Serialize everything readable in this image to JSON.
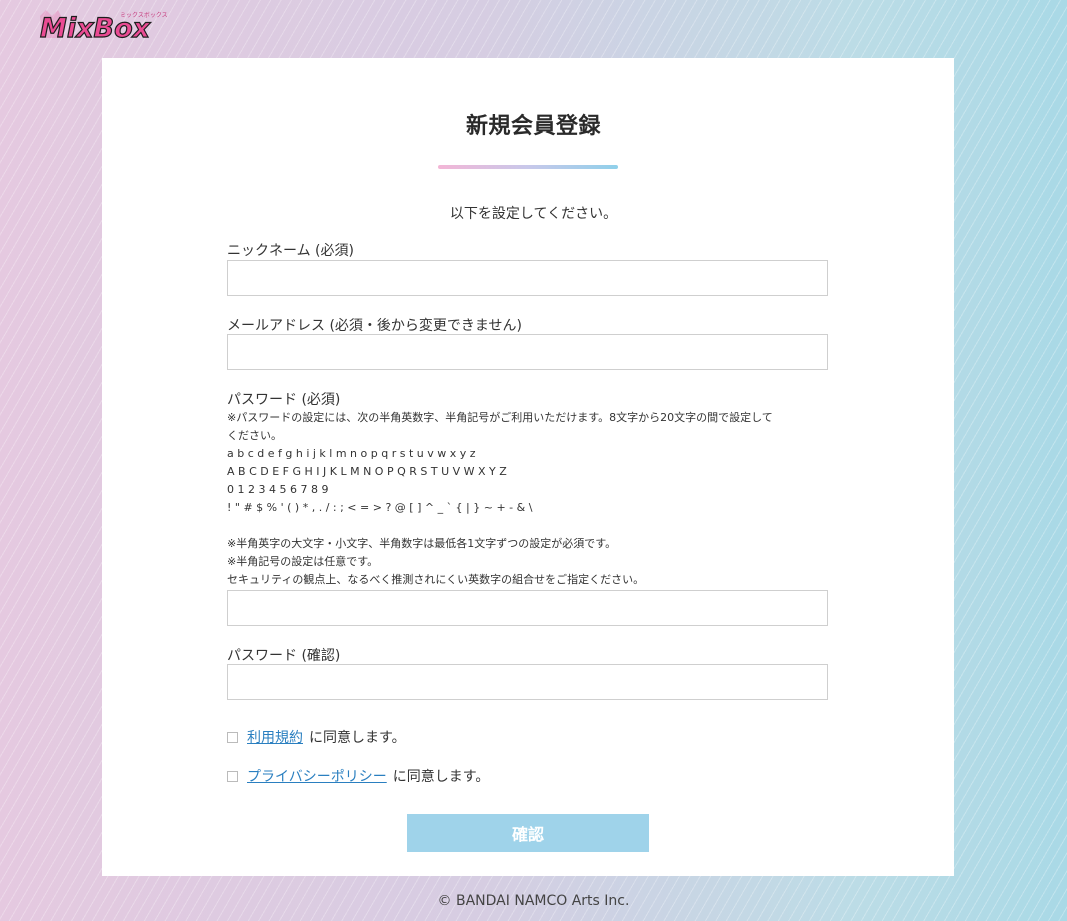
{
  "brand": {
    "logo_text": "MixBox",
    "logo_subtext": "ミックスボックス"
  },
  "form": {
    "title": "新規会員登録",
    "intro": "以下を設定してください。",
    "nickname": {
      "label": "ニックネーム (必須)",
      "value": "",
      "placeholder": ""
    },
    "email": {
      "label": "メールアドレス (必須・後から変更できません)",
      "value": "",
      "placeholder": ""
    },
    "password": {
      "label": "パスワード (必須)",
      "help_lines": [
        "※パスワードの設定には、次の半角英数字、半角記号がご利用いただけます。8文字から20文字の間で設定して",
        "ください。",
        "a b c d e f g h i j k l m n o p q r s t u v w x y z",
        "A B C D E F G H I J K L M N O P Q R S T U V W X Y Z",
        "0 1 2 3 4 5 6 7 8 9",
        "! \" # $ % ' ( ) * , . / : ; < = > ? @ [ ] ^ _ ` { | } ~ + - & \\"
      ],
      "notes": [
        "※半角英字の大文字・小文字、半角数字は最低各1文字ずつの設定が必須です。",
        "※半角記号の設定は任意です。",
        "セキュリティの観点上、なるべく推測されにくい英数字の組合せをご指定ください。"
      ],
      "value": "",
      "placeholder": ""
    },
    "password_confirm": {
      "label": "パスワード (確認)",
      "value": "",
      "placeholder": ""
    },
    "terms": {
      "checked": false,
      "link": "利用規約",
      "suffix": "に同意します。"
    },
    "privacy": {
      "checked": false,
      "link": "プライバシーポリシー",
      "suffix": "に同意します。"
    },
    "confirm_button": "確認"
  },
  "footer": {
    "copyright": "© BANDAI NAMCO Arts Inc."
  },
  "colors": {
    "button_disabled": "#9fd3ea",
    "link": "#2a7fc0",
    "bar_pink": "#f3b6d6",
    "bar_blue": "#8fd0ea"
  }
}
